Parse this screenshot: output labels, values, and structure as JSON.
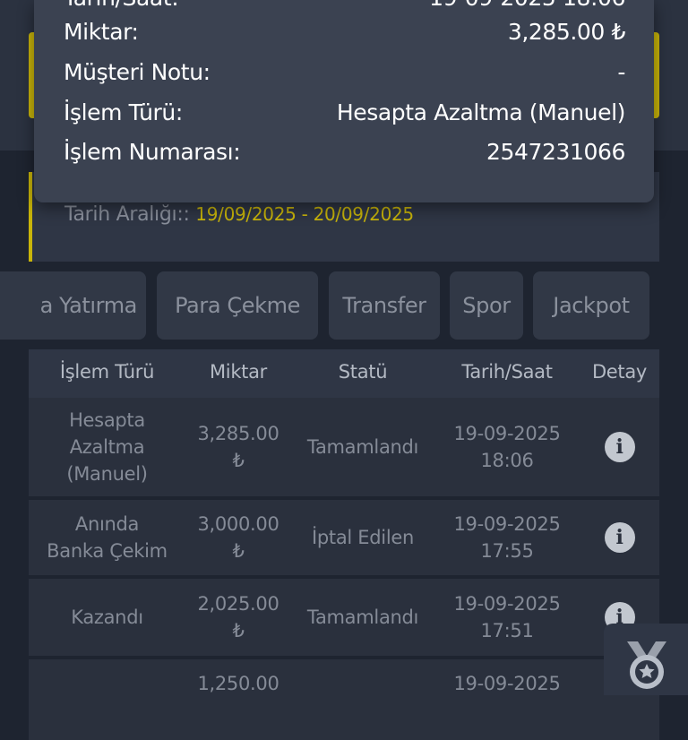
{
  "popup": {
    "rows": [
      {
        "label": "Miktar:",
        "value": "3,285.00 ₺"
      },
      {
        "label": "Müşteri Notu:",
        "value": "-"
      },
      {
        "label": "İşlem Türü:",
        "value": "Hesapta Azaltma (Manuel)"
      },
      {
        "label": "İşlem Numarası:",
        "value": "2547231066"
      }
    ]
  },
  "filter": {
    "date_label": "Tarih Aralığı::",
    "date_range": "19/09/2025 - 20/09/2025"
  },
  "tabs": [
    "a Yatırma",
    "Para Çekme",
    "Transfer",
    "Spor",
    "Jackpot"
  ],
  "table": {
    "headers": [
      "İşlem Türü",
      "Miktar",
      "Statü",
      "Tarih/Saat",
      "Detay"
    ],
    "rows": [
      {
        "type_lines": [
          "Hesapta",
          "Azaltma",
          "(Manuel)"
        ],
        "amount": "3,285.00",
        "currency": "₺",
        "status": "Tamamlandı",
        "date": "19-09-2025",
        "time": "18:06"
      },
      {
        "type_lines": [
          "Anında",
          "Banka Çekim"
        ],
        "amount": "3,000.00",
        "currency": "₺",
        "status": "İptal Edilen",
        "date": "19-09-2025",
        "time": "17:55"
      },
      {
        "type_lines": [
          "Kazandı"
        ],
        "amount": "2,025.00",
        "currency": "₺",
        "status": "Tamamlandı",
        "date": "19-09-2025",
        "time": "17:51"
      },
      {
        "type_lines": [
          ""
        ],
        "amount": "1,250.00",
        "currency": "",
        "status": "",
        "date": "19-09-2025",
        "time": ""
      }
    ],
    "info_glyph": "i"
  },
  "icons": {
    "info": "info-icon",
    "badge": "medal-icon"
  },
  "colors": {
    "accent": "#c9b50a",
    "background": "#1e2430",
    "panel": "#2f3645",
    "popup": "#3b4251"
  }
}
